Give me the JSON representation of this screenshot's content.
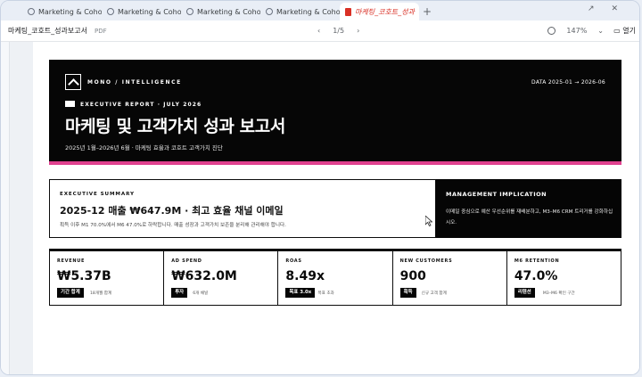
{
  "browser": {
    "tabs": [
      {
        "label": "Marketing & Coho",
        "active": false
      },
      {
        "label": "Marketing & Coho",
        "active": false
      },
      {
        "label": "Marketing & Coho",
        "active": false
      },
      {
        "label": "Marketing & Coho",
        "active": false
      },
      {
        "label": "마케팅_코호트_성과",
        "active": true
      }
    ],
    "new_tab": "+"
  },
  "toolbar": {
    "doc_title": "마케팅_코호트_성과보고서",
    "doc_type": "PDF",
    "page_indicator": "1/5",
    "zoom": "147%",
    "open_label": "열기"
  },
  "report": {
    "brand": "MONO / INTELLIGENCE",
    "data_range": "DATA 2025-01 → 2026-06",
    "eyebrow": "EXECUTIVE REPORT · JULY 2026",
    "title": "마케팅 및 고객가치 성과 보고서",
    "subtitle": "2025년 1월–2026년 6월 · 마케팅 효율과 코호트 고객가치 진단",
    "accent_color": "#e0418f",
    "summary": {
      "kicker": "EXECUTIVE SUMMARY",
      "headline": "2025-12 매출 ₩647.9M · 최고 효율 채널 이메일",
      "body": "획득 이후 M1 70.0%에서 M6 47.0%로 하락합니다. 매출 성장과 고객가치 보존을 분리해 관리해야 합니다."
    },
    "implication": {
      "kicker": "MANAGEMENT IMPLICATION",
      "body": "이메일 중심으로 예산 우선순위를 재배분하고, M3–M6 CRM 트리거를 강화하십시오."
    },
    "kpis": [
      {
        "label": "REVENUE",
        "value": "₩5.37B",
        "tag": "기간 합계",
        "note": "18개월 합계"
      },
      {
        "label": "AD SPEND",
        "value": "₩632.0M",
        "tag": "투자",
        "note": "6개 채널"
      },
      {
        "label": "ROAS",
        "value": "8.49x",
        "tag": "목표 3.0x",
        "note": "목표 초과"
      },
      {
        "label": "NEW CUSTOMERS",
        "value": "900",
        "tag": "획득",
        "note": "신규 고객 합계"
      },
      {
        "label": "M6 RETENTION",
        "value": "47.0%",
        "tag": "리텐션",
        "note": "M3–M6 확인 구간"
      }
    ]
  }
}
